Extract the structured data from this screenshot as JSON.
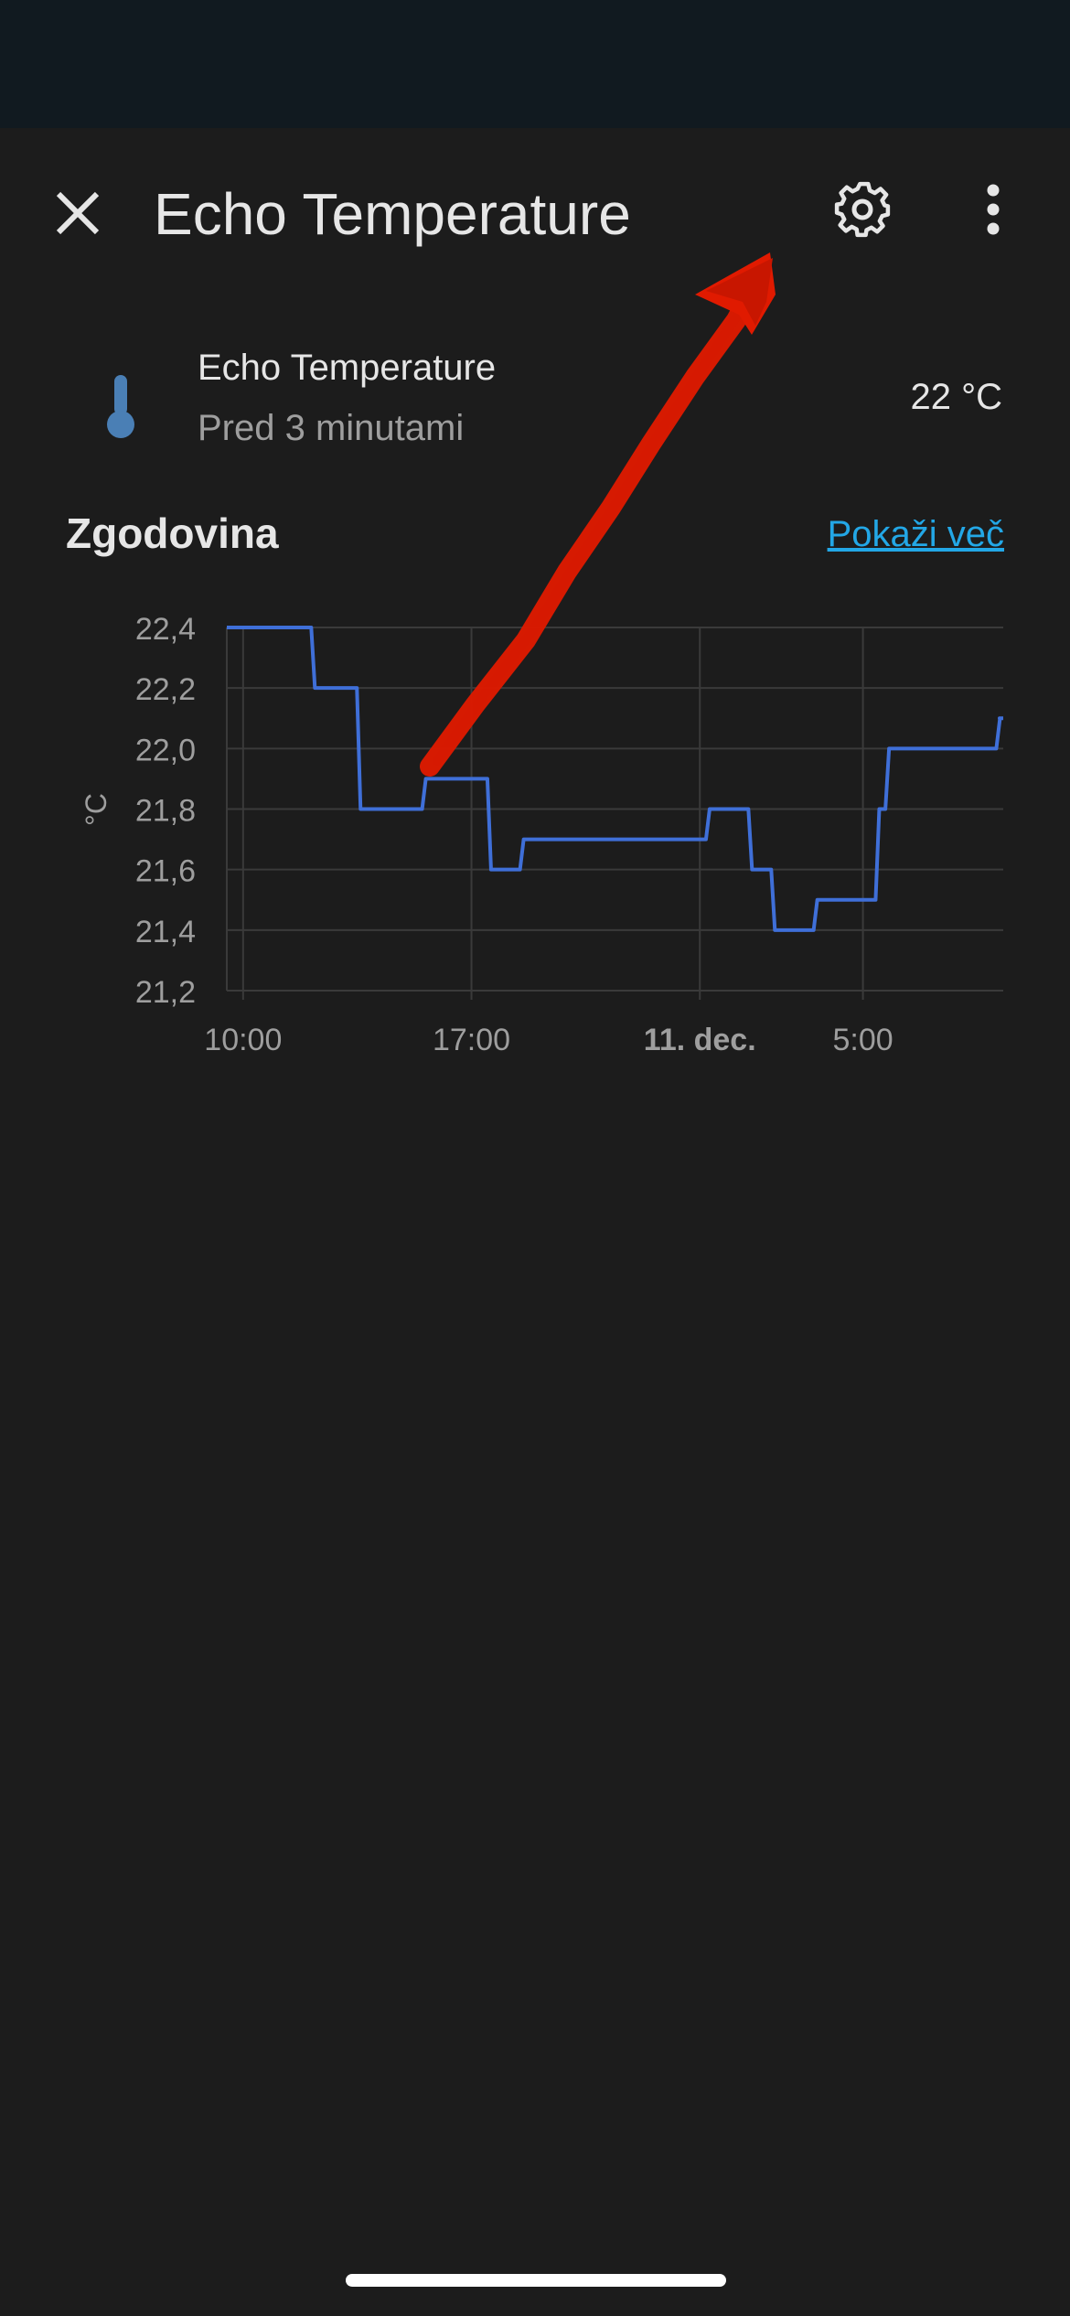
{
  "header": {
    "title": "Echo Temperature",
    "close_icon": "close-icon",
    "settings_icon": "gear-icon",
    "more_icon": "more-vertical-icon"
  },
  "entity": {
    "name": "Echo Temperature",
    "last_changed": "Pred 3 minutami",
    "state": "22 °C",
    "icon": "thermometer-icon",
    "icon_color": "#4a7fb5"
  },
  "history": {
    "title": "Zgodovina",
    "show_more": "Pokaži več",
    "link_color": "#23a7e6"
  },
  "chart_data": {
    "type": "line",
    "ylabel": "°C",
    "ylim": [
      21.2,
      22.4
    ],
    "yticks": [
      "22,4",
      "22,2",
      "22,0",
      "21,8",
      "21,6",
      "21,4",
      "21,2"
    ],
    "ytick_values": [
      22.4,
      22.2,
      22.0,
      21.8,
      21.6,
      21.4,
      21.2
    ],
    "xticks": [
      {
        "label": "10:00",
        "hour": 0,
        "bold": false
      },
      {
        "label": "17:00",
        "hour": 7,
        "bold": false
      },
      {
        "label": "11. dec.",
        "hour": 14,
        "bold": true
      },
      {
        "label": "5:00",
        "hour": 19,
        "bold": false
      }
    ],
    "x_range_hours": [
      -0.5,
      23.3
    ],
    "grid": true,
    "series": [
      {
        "color": "#3f6fd8",
        "step": true,
        "points": [
          [
            -0.5,
            22.4
          ],
          [
            2.2,
            22.2
          ],
          [
            3.6,
            21.8
          ],
          [
            5.6,
            21.9
          ],
          [
            7.6,
            21.6
          ],
          [
            8.6,
            21.7
          ],
          [
            14.3,
            21.8
          ],
          [
            15.6,
            21.6
          ],
          [
            16.3,
            21.4
          ],
          [
            17.6,
            21.5
          ],
          [
            19.5,
            21.8
          ],
          [
            19.8,
            22.0
          ],
          [
            23.2,
            22.1
          ],
          [
            23.3,
            22.1
          ]
        ]
      }
    ]
  },
  "annotation": {
    "arrow_color": "#e01a00",
    "arrow_icon": "annotation-arrow-icon"
  }
}
